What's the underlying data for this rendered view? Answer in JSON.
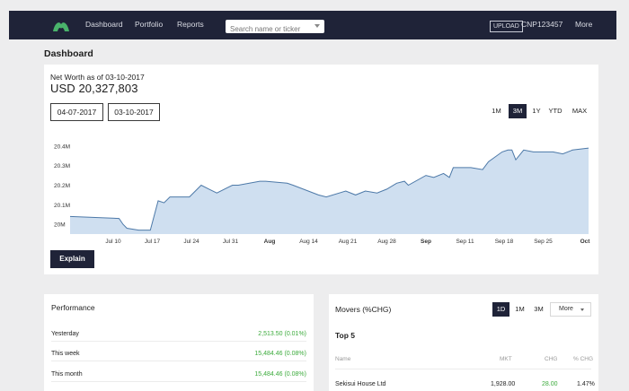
{
  "nav": {
    "links": [
      "Dashboard",
      "Portfolio",
      "Reports"
    ],
    "search_placeholder": "Search name or ticker",
    "upload": "UPLOAD",
    "account": "CNP123457",
    "more": "More"
  },
  "page_title": "Dashboard",
  "networth": {
    "label": "Net Worth as of 03-10-2017",
    "value": "USD 20,327,803",
    "start_date": "04-07-2017",
    "end_date": "03-10-2017",
    "ranges": [
      "1M",
      "3M",
      "1Y",
      "YTD",
      "MAX"
    ],
    "active_range": "3M",
    "explain_label": "Explain"
  },
  "chart_data": {
    "type": "area",
    "x_ticks": [
      "Jul 10",
      "Jul 17",
      "Jul 24",
      "Jul 31",
      "Aug",
      "Aug 14",
      "Aug 21",
      "Aug 28",
      "Sep",
      "Sep 11",
      "Sep 18",
      "Sep 25",
      "Oct"
    ],
    "y_ticks": [
      "20M",
      "20.1M",
      "20.2M",
      "20.3M",
      "20.4M"
    ],
    "ylim": [
      19.95,
      20.45
    ],
    "x": [
      0,
      0.15,
      0.25,
      0.35,
      0.65,
      0.95,
      1.15,
      1.3,
      1.45,
      1.95,
      2.25,
      2.45,
      2.65,
      3.05,
      3.2,
      3.75,
      3.9,
      4.45,
      4.6,
      5.25,
      5.45,
      5.95,
      6.2,
      6.45,
      6.75,
      7.0,
      7.25,
      7.45,
      7.55,
      8.0,
      8.2,
      8.45,
      8.6,
      8.7,
      9.15,
      9.45,
      9.6,
      9.95,
      10.1,
      10.2,
      10.3,
      10.5,
      10.75,
      11.25,
      11.5,
      11.75,
      12.0
    ],
    "values": [
      20.04,
      20.03,
      20.0,
      19.98,
      19.97,
      19.97,
      20.12,
      20.11,
      20.14,
      20.14,
      20.2,
      20.18,
      20.16,
      20.2,
      20.2,
      20.22,
      20.22,
      20.21,
      20.2,
      20.15,
      20.14,
      20.17,
      20.15,
      20.17,
      20.16,
      20.18,
      20.21,
      20.22,
      20.2,
      20.25,
      20.24,
      20.26,
      20.24,
      20.29,
      20.29,
      20.28,
      20.32,
      20.37,
      20.38,
      20.38,
      20.33,
      20.38,
      20.37,
      20.37,
      20.36,
      20.38,
      20.39
    ]
  },
  "performance": {
    "title": "Performance",
    "rows": [
      {
        "label": "Yesterday",
        "value": "2,513.50 (0.01%)"
      },
      {
        "label": "This week",
        "value": "15,484.46 (0.08%)"
      },
      {
        "label": "This month",
        "value": "15,484.46 (0.08%)"
      }
    ]
  },
  "movers": {
    "title": "Movers (%CHG)",
    "ranges": [
      "1D",
      "1M",
      "3M"
    ],
    "active_range": "1D",
    "more": "More",
    "top_label": "Top 5",
    "headers": [
      "Name",
      "MKT",
      "CHG",
      "% CHG"
    ],
    "rows": [
      {
        "name": "Sekisui House Ltd",
        "mkt": "1,928.00",
        "chg": "28.00",
        "pct": "1.47%"
      }
    ]
  },
  "colors": {
    "nav_bg": "#1f2338",
    "accent_green": "#3cab3c",
    "area_fill": "#cfdff0",
    "line": "#4d79a8"
  }
}
